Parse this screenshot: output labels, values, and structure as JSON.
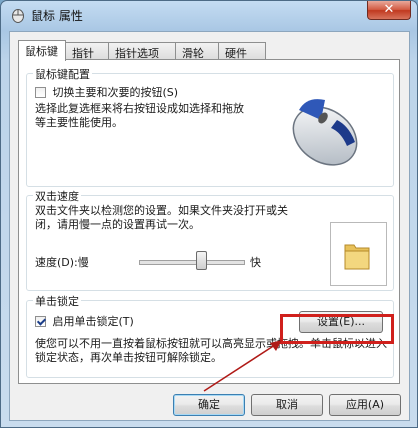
{
  "window": {
    "title": "鼠标 属性",
    "close_label": "✕"
  },
  "tabs": [
    {
      "label": "鼠标键"
    },
    {
      "label": "指针"
    },
    {
      "label": "指针选项"
    },
    {
      "label": "滑轮"
    },
    {
      "label": "硬件"
    }
  ],
  "button_config": {
    "group_label": "鼠标键配置",
    "swap_label": "切换主要和次要的按钮(S)",
    "swap_checked": false,
    "description": "选择此复选框来将右按钮设成如选择和拖放等主要性能使用。"
  },
  "double_click": {
    "group_label": "双击速度",
    "description": "双击文件夹以检测您的设置。如果文件夹没打开或关闭，请用慢一点的设置再试一次。",
    "speed_label": "速度(D):",
    "slow_label": "慢",
    "fast_label": "快"
  },
  "click_lock": {
    "group_label": "单击锁定",
    "enable_label": "启用单击锁定(T)",
    "enable_checked": true,
    "settings_button": "设置(E)...",
    "description": "使您可以不用一直按着鼠标按钮就可以高亮显示或拖拽。单击鼠标以进入锁定状态，再次单击按钮可解除锁定。"
  },
  "footer": {
    "ok": "确定",
    "cancel": "取消",
    "apply": "应用(A)"
  },
  "colors": {
    "highlight": "#d0201c",
    "accent": "#2a6fc0"
  }
}
